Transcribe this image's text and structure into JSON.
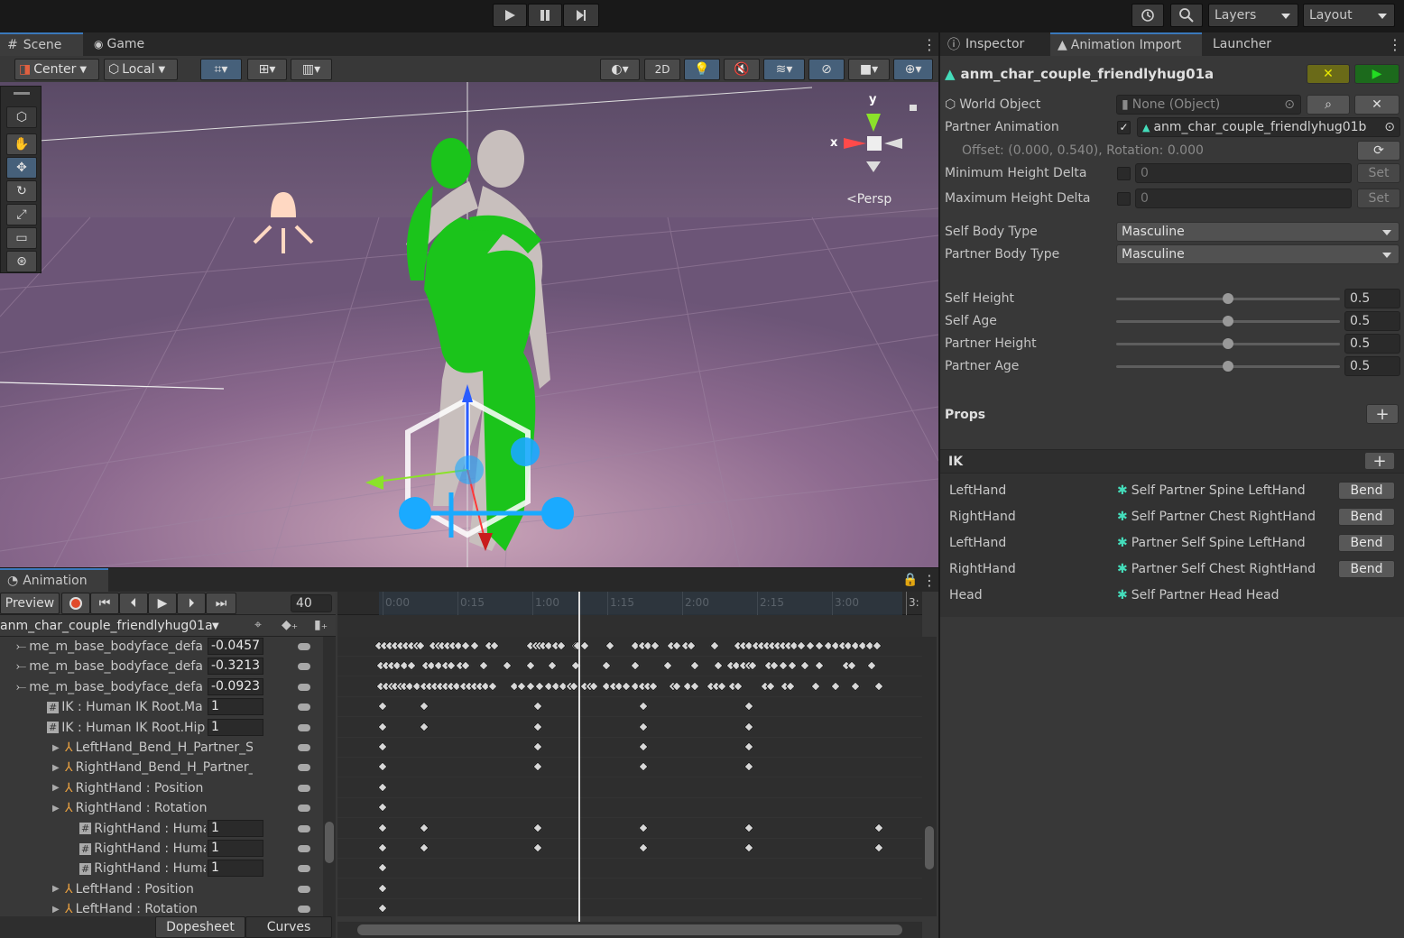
{
  "topbar": {
    "layers": "Layers",
    "layout": "Layout"
  },
  "scene_tabs": {
    "scene": "Scene",
    "game": "Game"
  },
  "scene_toolbar": {
    "pivot": "Center",
    "space": "Local",
    "mode_2d": "2D"
  },
  "scene_view": {
    "persp": "Persp",
    "gizmo_y": "y",
    "gizmo_x": "x"
  },
  "inspector_tabs": {
    "inspector": "Inspector",
    "animation_import": "Animation Import",
    "launcher": "Launcher"
  },
  "inspector": {
    "title": "anm_char_couple_friendlyhug01a",
    "world_object_label": "World Object",
    "world_object_value": "None (Object)",
    "partner_animation_label": "Partner Animation",
    "partner_animation_value": "anm_char_couple_friendlyhug01b",
    "offset_text": "Offset: (0.000, 0.540), Rotation: 0.000",
    "min_height_label": "Minimum Height Delta",
    "min_height_value": "0",
    "max_height_label": "Maximum Height Delta",
    "max_height_value": "0",
    "set_label": "Set",
    "self_body_label": "Self Body Type",
    "self_body_value": "Masculine",
    "partner_body_label": "Partner Body Type",
    "partner_body_value": "Masculine",
    "sliders": [
      {
        "label": "Self Height",
        "value": "0.5",
        "fraction": 0.5
      },
      {
        "label": "Self Age",
        "value": "0.5",
        "fraction": 0.5
      },
      {
        "label": "Partner Height",
        "value": "0.5",
        "fraction": 0.5
      },
      {
        "label": "Partner Age",
        "value": "0.5",
        "fraction": 0.5
      }
    ],
    "props_label": "Props",
    "ik_label": "IK",
    "ik_rows": [
      {
        "part": "LeftHand",
        "target": "Self Partner Spine LeftHand",
        "button": "Bend"
      },
      {
        "part": "RightHand",
        "target": "Self Partner Chest RightHand",
        "button": "Bend"
      },
      {
        "part": "LeftHand",
        "target": "Partner Self Spine LeftHand",
        "button": "Bend"
      },
      {
        "part": "RightHand",
        "target": "Partner Self Chest RightHand",
        "button": "Bend"
      },
      {
        "part": "Head",
        "target": "Self Partner Head Head",
        "button": ""
      }
    ]
  },
  "animation": {
    "tab": "Animation",
    "preview": "Preview",
    "frame": "40",
    "clip": "anm_char_couple_friendlyhug01a",
    "timeline": [
      "0:00",
      "0:15",
      "1:00",
      "1:15",
      "2:00",
      "2:15",
      "3:00",
      "3:"
    ],
    "properties": [
      {
        "name": "me_m_base_bodyface_defa",
        "value": "-0.0457"
      },
      {
        "name": "me_m_base_bodyface_defa",
        "value": "-0.3213"
      },
      {
        "name": "me_m_base_bodyface_defa",
        "value": "-0.0923"
      },
      {
        "name": "IK : Human IK Root.Ma",
        "value": "1"
      },
      {
        "name": "IK : Human IK Root.Hip",
        "value": "1"
      },
      {
        "name": "LeftHand_Bend_H_Partner_Self_Spir",
        "value": ""
      },
      {
        "name": "RightHand_Bend_H_Partner_Self_Ch",
        "value": ""
      },
      {
        "name": "RightHand : Position",
        "value": ""
      },
      {
        "name": "RightHand : Rotation",
        "value": ""
      },
      {
        "name": "RightHand : Huma",
        "value": "1"
      },
      {
        "name": "RightHand : Huma",
        "value": "1"
      },
      {
        "name": "RightHand : Huma",
        "value": "1"
      },
      {
        "name": "LeftHand : Position",
        "value": ""
      },
      {
        "name": "LeftHand : Rotation",
        "value": ""
      }
    ],
    "dopesheet": "Dopesheet",
    "curves": "Curves"
  }
}
